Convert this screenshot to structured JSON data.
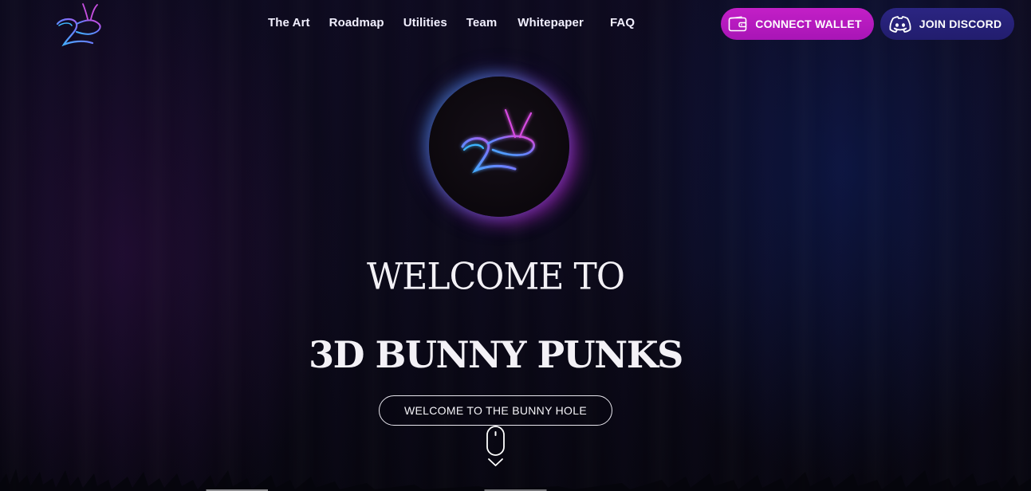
{
  "nav": {
    "items": [
      {
        "label": "The Art"
      },
      {
        "label": "Roadmap"
      },
      {
        "label": "Utilities"
      },
      {
        "label": "Team"
      },
      {
        "label": "Whitepaper"
      },
      {
        "label": "FAQ"
      }
    ]
  },
  "header": {
    "logo_icon": "neon-bunny-logo-icon",
    "connect_wallet_label": "CONNECT WALLET",
    "connect_wallet_icon": "wallet-icon",
    "join_discord_label": "JOIN DISCORD",
    "join_discord_icon": "discord-icon"
  },
  "hero": {
    "emblem_icon": "neon-bunny-emblem-icon",
    "title_line1": "WELCOME TO",
    "title_line2": "3D BUNNY PUNKS",
    "cta_label": "WELCOME TO THE BUNNY HOLE",
    "scroll_icon": "scroll-down-mouse-icon"
  },
  "colors": {
    "wallet_button": "#b81ac0",
    "discord_button": "#262077",
    "neon_blue": "#3aa8ff",
    "neon_pink": "#e23bd6",
    "background": "#0c0a1c"
  }
}
